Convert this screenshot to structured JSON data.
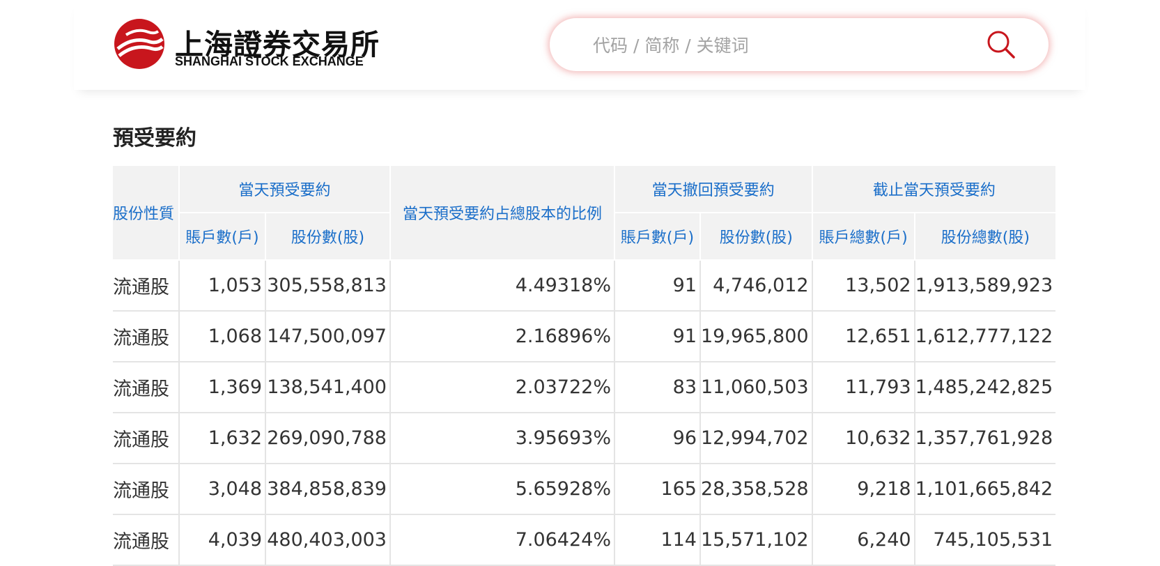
{
  "header": {
    "logo_cn": "上海證券交易所",
    "logo_en": "SHANGHAI STOCK EXCHANGE",
    "logo_icon": "sse-logo-mark",
    "brand_color": "#c8161d",
    "search_placeholder": "代码 / 简称 / 关键词",
    "search_icon": "search-icon"
  },
  "page": {
    "title": "預受要約"
  },
  "table": {
    "col_share_type": "股份性質",
    "group_today": "當天預受要約",
    "col_ratio": "當天預受要約占總股本的比例",
    "group_withdraw": "當天撤回預受要約",
    "group_total": "截止當天預受要約",
    "sub_accounts": "賬戶數(戶)",
    "sub_shares": "股份數(股)",
    "sub_accounts_total": "賬戶總數(戶)",
    "sub_shares_total": "股份總數(股)",
    "rows": [
      {
        "type": "流通股",
        "acc": "1,053",
        "shares": "305,558,813",
        "ratio": "4.49318%",
        "w_acc": "91",
        "w_shares": "4,746,012",
        "t_acc": "13,502",
        "t_shares": "1,913,589,923"
      },
      {
        "type": "流通股",
        "acc": "1,068",
        "shares": "147,500,097",
        "ratio": "2.16896%",
        "w_acc": "91",
        "w_shares": "19,965,800",
        "t_acc": "12,651",
        "t_shares": "1,612,777,122"
      },
      {
        "type": "流通股",
        "acc": "1,369",
        "shares": "138,541,400",
        "ratio": "2.03722%",
        "w_acc": "83",
        "w_shares": "11,060,503",
        "t_acc": "11,793",
        "t_shares": "1,485,242,825"
      },
      {
        "type": "流通股",
        "acc": "1,632",
        "shares": "269,090,788",
        "ratio": "3.95693%",
        "w_acc": "96",
        "w_shares": "12,994,702",
        "t_acc": "10,632",
        "t_shares": "1,357,761,928"
      },
      {
        "type": "流通股",
        "acc": "3,048",
        "shares": "384,858,839",
        "ratio": "5.65928%",
        "w_acc": "165",
        "w_shares": "28,358,528",
        "t_acc": "9,218",
        "t_shares": "1,101,665,842"
      },
      {
        "type": "流通股",
        "acc": "4,039",
        "shares": "480,403,003",
        "ratio": "7.06424%",
        "w_acc": "114",
        "w_shares": "15,571,102",
        "t_acc": "6,240",
        "t_shares": "745,105,531"
      }
    ]
  }
}
